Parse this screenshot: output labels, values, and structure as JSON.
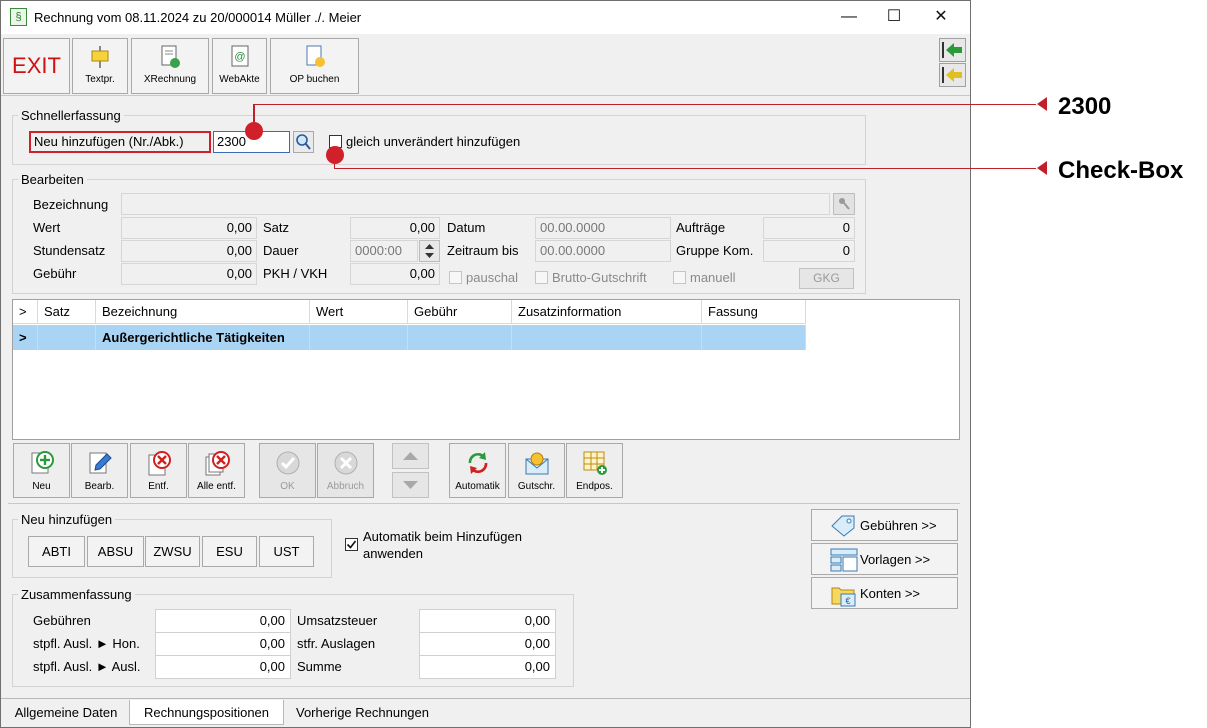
{
  "window": {
    "title": "Rechnung vom 08.11.2024 zu 20/000014  Müller ./. Meier",
    "app_icon": "§"
  },
  "toolbar": {
    "exit": "EXIT",
    "buttons": [
      {
        "label": "Textpr.",
        "icon": "text-print-icon"
      },
      {
        "label": "XRechnung",
        "icon": "xrechnung-icon"
      },
      {
        "label": "WebAkte",
        "icon": "webakte-icon"
      },
      {
        "label": "OP buchen",
        "icon": "op-buchen-icon"
      }
    ]
  },
  "schnellerfassung": {
    "title": "Schnellerfassung",
    "label": "Neu hinzufügen (Nr./Abk.)",
    "input_value": "2300",
    "checkbox_label": "gleich unverändert hinzufügen"
  },
  "bearbeiten": {
    "title": "Bearbeiten",
    "labels": {
      "bezeichnung": "Bezeichnung",
      "wert": "Wert",
      "stundensatz": "Stundensatz",
      "gebuehr": "Gebühr",
      "satz": "Satz",
      "dauer": "Dauer",
      "pkh": "PKH / VKH",
      "datum": "Datum",
      "zeitraum_bis": "Zeitraum bis",
      "auftraege": "Aufträge",
      "gruppe_kom": "Gruppe Kom."
    },
    "values": {
      "wert": "0,00",
      "stundensatz": "0,00",
      "gebuehr": "0,00",
      "satz": "0,00",
      "dauer": "0000:00",
      "pkh": "0,00",
      "datum": "00.00.0000",
      "zeitraum_bis": "00.00.0000",
      "auftraege": "0",
      "gruppe_kom": "0"
    },
    "checkboxes": {
      "pauschal": "pauschal",
      "brutto": "Brutto-Gutschrift",
      "manuell": "manuell"
    },
    "gkg_button": "GKG"
  },
  "table": {
    "headers": [
      ">",
      "Satz",
      "Bezeichnung",
      "Wert",
      "Gebühr",
      "Zusatzinformation",
      "Fassung"
    ],
    "rows": [
      {
        "marker": ">",
        "satz": "",
        "bezeichnung": "Außergerichtliche Tätigkeiten",
        "wert": "",
        "gebuehr": "",
        "zusatz": "",
        "fassung": ""
      }
    ]
  },
  "actions": {
    "neu": "Neu",
    "bearb": "Bearb.",
    "entf": "Entf.",
    "alle_entf": "Alle entf.",
    "ok": "OK",
    "abbruch": "Abbruch",
    "automatik": "Automatik",
    "gutschr": "Gutschr.",
    "endpos": "Endpos."
  },
  "neu_hinzufuegen": {
    "title": "Neu hinzufügen",
    "buttons": [
      "ABTI",
      "ABSU",
      "ZWSU",
      "ESU",
      "UST"
    ],
    "checkbox_label_1": "Automatik beim Hinzufügen",
    "checkbox_label_2": "anwenden",
    "checked": true
  },
  "right_buttons": {
    "gebuehren": "Gebühren >>",
    "vorlagen": "Vorlagen >>",
    "konten": "Konten >>"
  },
  "zusammenfassung": {
    "title": "Zusammenfassung",
    "labels": {
      "gebuehren": "Gebühren",
      "stpfl_hon": "stpfl. Ausl. ► Hon.",
      "stpfl_ausl": "stpfl. Ausl. ► Ausl.",
      "umsatzsteuer": "Umsatzsteuer",
      "stfr": "stfr. Auslagen",
      "summe": "Summe"
    },
    "values": {
      "gebuehren": "0,00",
      "stpfl_hon": "0,00",
      "stpfl_ausl": "0,00",
      "umsatzsteuer": "0,00",
      "stfr": "0,00",
      "summe": "0,00"
    }
  },
  "tabs": [
    "Allgemeine Daten",
    "Rechnungspositionen",
    "Vorherige Rechnungen"
  ],
  "annotations": {
    "value": "2300",
    "checkbox": "Check-Box"
  },
  "colors": {
    "accent_red": "#c0202a",
    "selection": "#aad4f4"
  }
}
